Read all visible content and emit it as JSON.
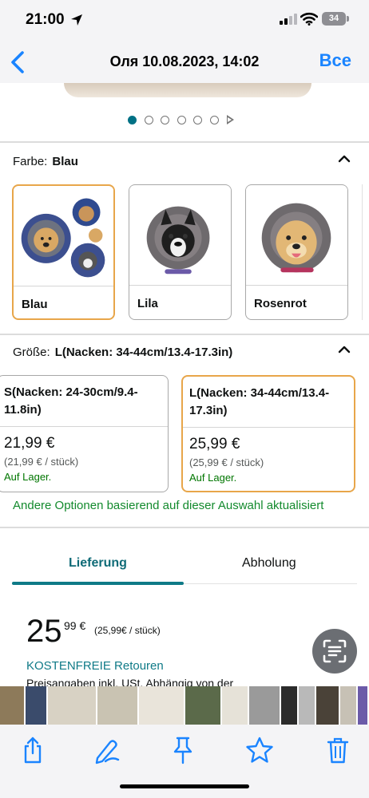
{
  "status_bar": {
    "time": "21:00",
    "battery": "34"
  },
  "nav": {
    "title": "Оля 10.08.2023, 14:02",
    "all_label": "Все"
  },
  "gallery": {
    "dot_count": 6,
    "active_dot": 0
  },
  "color_section": {
    "label": "Farbe:",
    "value": "Blau",
    "options": [
      {
        "name": "Blau",
        "selected": true
      },
      {
        "name": "Lila",
        "selected": false
      },
      {
        "name": "Rosenrot",
        "selected": false
      }
    ]
  },
  "size_section": {
    "label": "Größe:",
    "value": "L(Nacken: 34-44cm/13.4-17.3in)",
    "options": [
      {
        "name": "S(Nacken: 24-30cm/9.4-11.8in)",
        "price": "21,99 €",
        "unit_price": "(21,99 € / stück)",
        "stock": "Auf Lager.",
        "selected": false
      },
      {
        "name": "L(Nacken: 34-44cm/13.4-17.3in)",
        "price": "25,99 €",
        "unit_price": "(25,99 € / stück)",
        "stock": "Auf Lager.",
        "selected": true
      }
    ],
    "update_note": "Andere Optionen basierend auf dieser Auswahl aktualisiert"
  },
  "tabs": {
    "delivery": "Lieferung",
    "pickup": "Abholung",
    "active": "delivery"
  },
  "price_block": {
    "whole": "25",
    "cents": "99 €",
    "unit_price": "(25,99€ / stück)",
    "free_returns": "KOSTENFREIE Retouren",
    "price_info": "Preisangaben inkl. USt. Abhängig von der"
  },
  "colors": {
    "accent_blue": "#1a84ff",
    "teal": "#0f7a87",
    "selected_border": "#e8a64a",
    "stock_green": "#007600"
  },
  "icons": [
    "location-arrow-icon",
    "signal-icon",
    "wifi-icon",
    "battery-icon",
    "back-chevron-icon",
    "text-scan-icon",
    "share-icon",
    "markup-icon",
    "pin-icon",
    "star-icon",
    "trash-icon"
  ]
}
